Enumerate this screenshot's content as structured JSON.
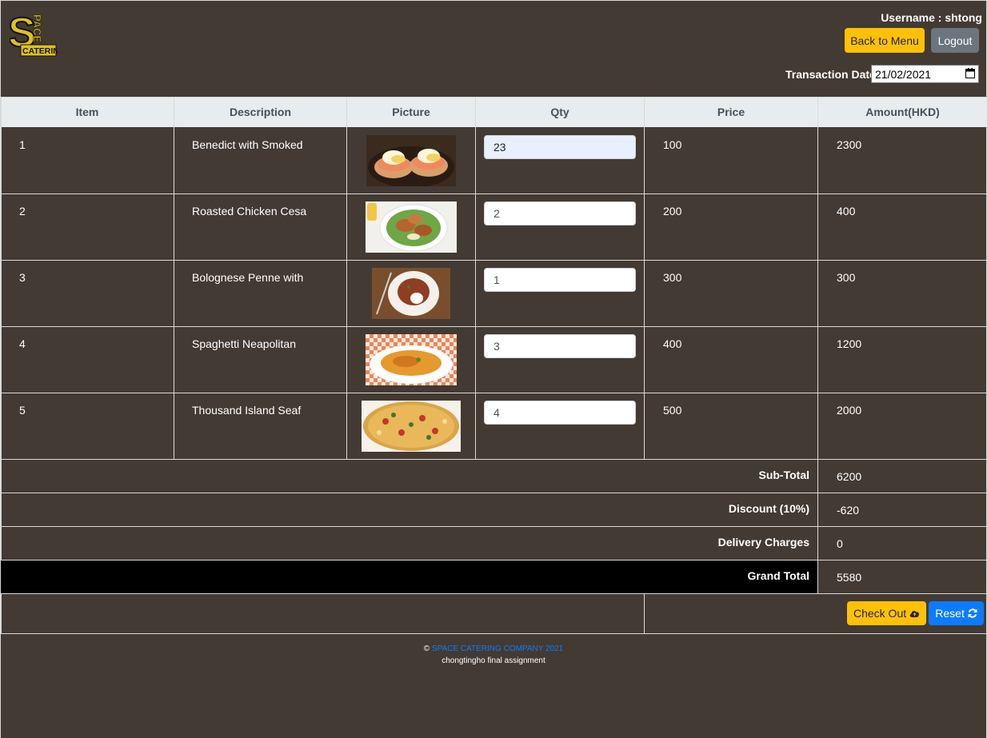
{
  "header": {
    "logo_text_top": "PACE",
    "logo_letter": "S",
    "logo_text_bottom": "CATERING",
    "username_label": "Username : shtong",
    "back_button": "Back to Menu",
    "logout_button": "Logout",
    "transaction_date_label": "Transaction Date :",
    "transaction_date_value": "21/02/2021"
  },
  "table": {
    "columns": [
      "Item",
      "Description",
      "Picture",
      "Qty",
      "Price",
      "Amount(HKD)"
    ],
    "rows": [
      {
        "item": "1",
        "description": "Benedict with Smoked",
        "qty": "23",
        "price": "100",
        "amount": "2300",
        "picture_icon": "eggs-benedict-photo"
      },
      {
        "item": "2",
        "description": "Roasted Chicken Cesa",
        "qty": "2",
        "price": "200",
        "amount": "400",
        "picture_icon": "chicken-caesar-photo"
      },
      {
        "item": "3",
        "description": "Bolognese Penne with",
        "qty": "1",
        "price": "300",
        "amount": "300",
        "picture_icon": "bolognese-penne-photo"
      },
      {
        "item": "4",
        "description": "Spaghetti Neapolitan",
        "qty": "3",
        "price": "400",
        "amount": "1200",
        "picture_icon": "spaghetti-photo"
      },
      {
        "item": "5",
        "description": "Thousand Island Seaf",
        "qty": "4",
        "price": "500",
        "amount": "2000",
        "picture_icon": "seafood-pizza-photo"
      }
    ]
  },
  "totals": {
    "subtotal_label": "Sub-Total",
    "subtotal_value": "6200",
    "discount_label": "Discount (10%)",
    "discount_value": "-620",
    "delivery_label": "Delivery Charges",
    "delivery_value": "0",
    "grand_label": "Grand Total",
    "grand_value": "5580"
  },
  "actions": {
    "checkout_button": "Check Out",
    "reset_button": "Reset"
  },
  "footer": {
    "copyright_symbol": "©",
    "company": "SPACE CATERING COMPANY 2021",
    "note": "chongtingho final assignment"
  },
  "colors": {
    "background": "#433a33",
    "header_row": "#e9ecef",
    "warning_button": "#ffc107",
    "secondary_button": "#6c757d",
    "primary_button": "#0d7bff",
    "grand_total_band": "#000000"
  }
}
